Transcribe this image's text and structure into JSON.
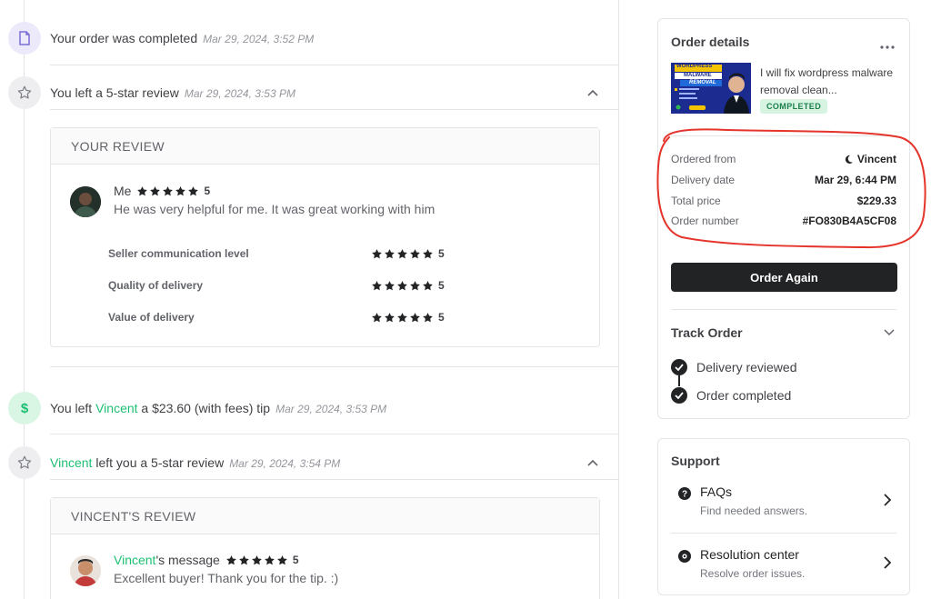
{
  "timeline": {
    "event_completed": {
      "text": "Your order was completed",
      "time": "Mar 29, 2024, 3:52 PM"
    },
    "event_you_reviewed": {
      "text": "You left a 5-star review",
      "time": "Mar 29, 2024, 3:53 PM"
    },
    "your_review": {
      "heading": "YOUR REVIEW",
      "author": "Me",
      "rating": "5",
      "message": "He was very helpful for me. It was great working with him",
      "breakdown": [
        {
          "label": "Seller communication level",
          "rating": "5"
        },
        {
          "label": "Quality of delivery",
          "rating": "5"
        },
        {
          "label": "Value of delivery",
          "rating": "5"
        }
      ]
    },
    "event_tip": {
      "prefix": "You left ",
      "name": "Vincent",
      "suffix": " a $23.60 (with fees) tip",
      "time": "Mar 29, 2024, 3:53 PM"
    },
    "event_seller_reviewed": {
      "name": "Vincent",
      "suffix": " left you a 5-star review",
      "time": "Mar 29, 2024, 3:54 PM"
    },
    "seller_review": {
      "heading": "VINCENT'S REVIEW",
      "author": "Vincent",
      "author_suffix": "'s message",
      "rating": "5",
      "message": "Excellent buyer! Thank you for the tip. :)"
    }
  },
  "order_details": {
    "title": "Order details",
    "gig_title": "I will fix wordpress malware removal clean...",
    "thumb_line1": "WORDPRESS",
    "thumb_line2": "MALWARE",
    "thumb_line3": "REMOVAL",
    "status_badge": "COMPLETED",
    "rows": [
      {
        "label": "Ordered from",
        "value": "Vincent"
      },
      {
        "label": "Delivery date",
        "value": "Mar 29, 6:44 PM"
      },
      {
        "label": "Total price",
        "value": "$229.33"
      },
      {
        "label": "Order number",
        "value": "#FO830B4A5CF08"
      }
    ],
    "order_again_label": "Order Again",
    "track_title": "Track Order",
    "track_steps": [
      "Delivery reviewed",
      "Order completed"
    ]
  },
  "support": {
    "title": "Support",
    "items": [
      {
        "title": "FAQs",
        "subtitle": "Find needed answers."
      },
      {
        "title": "Resolution center",
        "subtitle": "Resolve order issues."
      }
    ]
  },
  "colors": {
    "accent_green": "#1dbf73",
    "annotation_red": "#e5342b",
    "dark": "#222325"
  },
  "icons": [
    "document-icon",
    "star-outline-icon",
    "dollar-icon",
    "chevron-up-icon",
    "more-icon",
    "moon-icon",
    "check-icon",
    "chevron-down-icon",
    "question-icon",
    "lifebuoy-icon",
    "chevron-right-icon"
  ]
}
